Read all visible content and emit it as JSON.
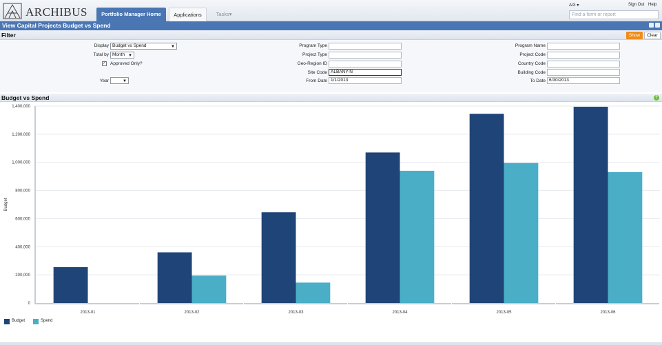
{
  "header": {
    "logo_text": "ARCHIBUS",
    "tabs": [
      {
        "label": "Portfolio Manager Home"
      },
      {
        "label": "Applications"
      },
      {
        "label": "Tasks"
      }
    ],
    "user": "AIX",
    "sign_out": "Sign Out",
    "help": "Help",
    "search_placeholder": "Find a form or report"
  },
  "page": {
    "title": "View Capital Projects Budget vs Spend"
  },
  "filter": {
    "title": "Filter",
    "show_label": "Show",
    "clear_label": "Clear",
    "display": {
      "label": "Display",
      "value": "Budget vs Spend"
    },
    "total_by": {
      "label": "Total by",
      "value": "Month"
    },
    "approved": {
      "label": "Approved Only?",
      "checked": true
    },
    "year": {
      "label": "Year",
      "value": ""
    },
    "program_type": {
      "label": "Program Type",
      "value": ""
    },
    "project_type": {
      "label": "Project Type",
      "value": ""
    },
    "geo_region": {
      "label": "Geo-Region ID",
      "value": ""
    },
    "site_code": {
      "label": "Site Code",
      "value": "ALBANY-N"
    },
    "from_date": {
      "label": "From Date",
      "value": "1/1/2013"
    },
    "program_name": {
      "label": "Program Name",
      "value": ""
    },
    "project_code": {
      "label": "Project Code",
      "value": ""
    },
    "country_code": {
      "label": "Country Code",
      "value": ""
    },
    "building_code": {
      "label": "Building Code",
      "value": ""
    },
    "to_date": {
      "label": "To Date",
      "value": "6/30/2013"
    }
  },
  "panel": {
    "title": "Budget vs Spend"
  },
  "colors": {
    "accent": "#4a76b3",
    "show_button": "#f08c1c",
    "budget": "#1f4478",
    "spend": "#4aaec7"
  },
  "chart_data": {
    "type": "bar",
    "categories": [
      "2013-01",
      "2013-02",
      "2013-03",
      "2013-04",
      "2013-05",
      "2013-06"
    ],
    "series": [
      {
        "name": "Budget",
        "values": [
          255000,
          360000,
          645000,
          1070000,
          1345000,
          1395000
        ]
      },
      {
        "name": "Spend",
        "values": [
          0,
          195000,
          145000,
          940000,
          995000,
          930000
        ]
      }
    ],
    "ylabel": "Budget",
    "ylim": [
      0,
      1400000
    ],
    "yticks": [
      0,
      200000,
      400000,
      600000,
      800000,
      1000000,
      1200000,
      1400000
    ],
    "ytick_labels": [
      "0",
      "200,000",
      "400,000",
      "600,000",
      "800,000",
      "1,000,000",
      "1,200,000",
      "1,400,000"
    ],
    "grid": true,
    "legend": "bottom-left"
  }
}
